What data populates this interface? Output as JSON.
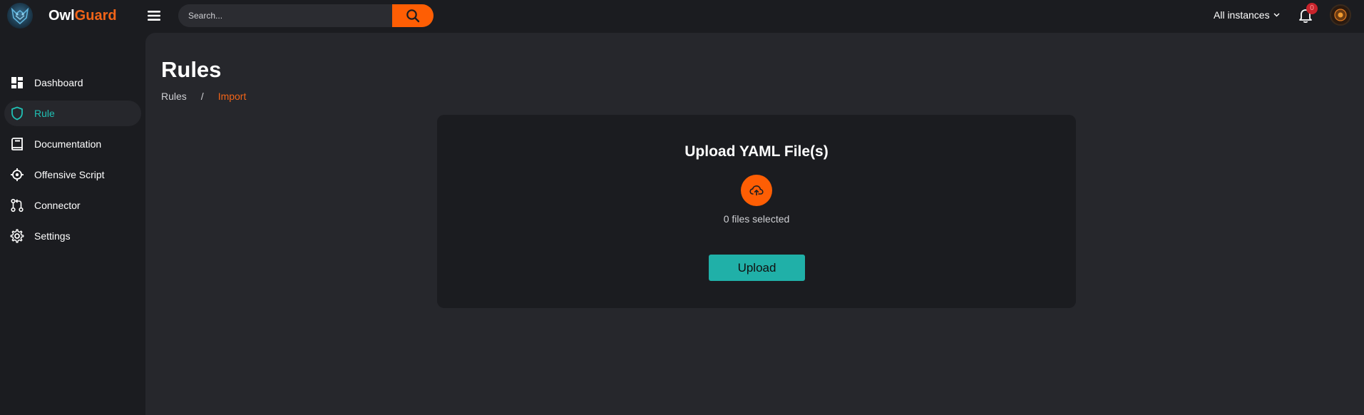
{
  "brand": {
    "name_part1": "Owl",
    "name_part2": "Guard"
  },
  "header": {
    "search": {
      "placeholder": "Search...",
      "value": ""
    },
    "instances_label": "All instances",
    "notifications_count": "0"
  },
  "sidebar": {
    "items": [
      {
        "label": "Dashboard",
        "icon": "dashboard-icon",
        "active": false
      },
      {
        "label": "Rule",
        "icon": "shield-icon",
        "active": true
      },
      {
        "label": "Documentation",
        "icon": "book-icon",
        "active": false
      },
      {
        "label": "Offensive Script",
        "icon": "crosshair-icon",
        "active": false
      },
      {
        "label": "Connector",
        "icon": "git-pull-request-icon",
        "active": false
      },
      {
        "label": "Settings",
        "icon": "gear-icon",
        "active": false
      }
    ]
  },
  "main": {
    "title": "Rules",
    "breadcrumb": {
      "parent": "Rules",
      "separator": "/",
      "current": "Import"
    },
    "upload_card": {
      "title": "Upload YAML File(s)",
      "files_selected": "0 files selected",
      "upload_label": "Upload"
    }
  },
  "colors": {
    "accent_orange": "#fe5e04",
    "accent_teal": "#20b0a8",
    "background": "#1b1c20",
    "panel": "#26272c"
  }
}
